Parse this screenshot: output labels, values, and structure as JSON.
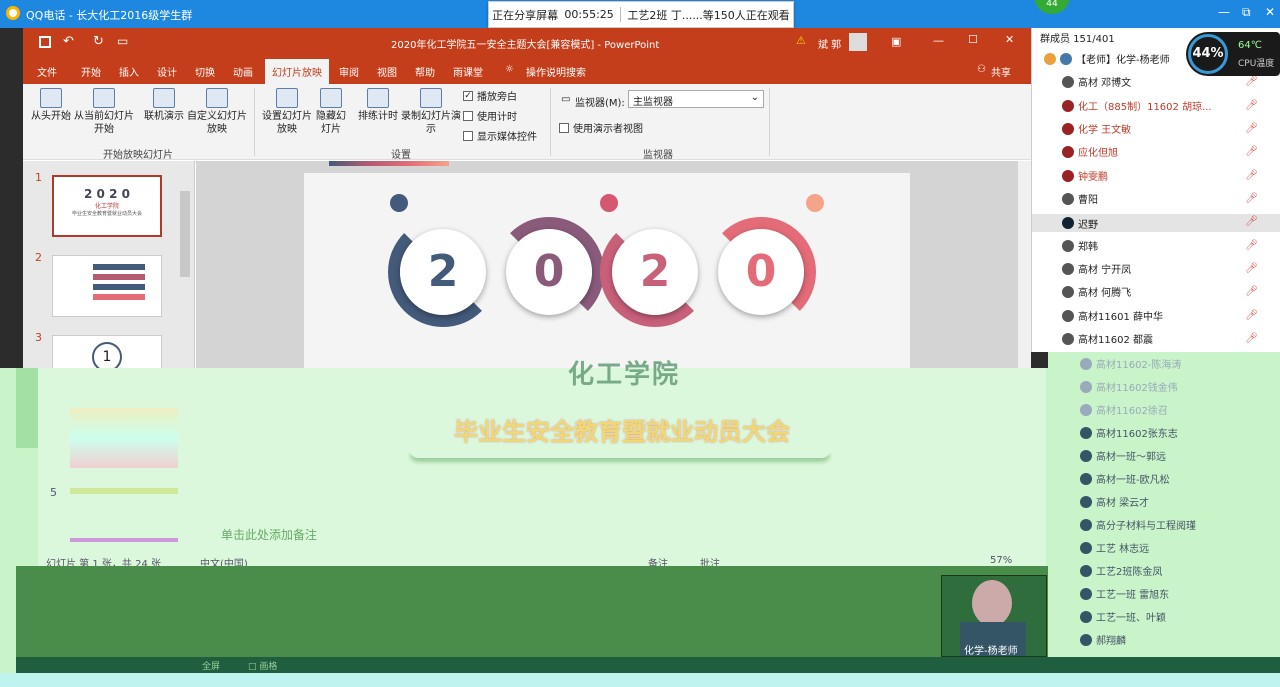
{
  "qq": {
    "title": "QQ电话 - 长大化工2016级学生群",
    "badge": "44",
    "minimize": "—",
    "restore": "⧉",
    "close": "✕"
  },
  "share": {
    "status": "正在分享屏幕",
    "time": "00:55:25",
    "viewers": "工艺2班 丁......等150人正在观看"
  },
  "ppt": {
    "title": "2020年化工学院五一安全主题大会[兼容模式] - PowerPoint",
    "user": "斌 郭",
    "warning": "⚠",
    "tabs": [
      "文件",
      "开始",
      "插入",
      "设计",
      "切换",
      "动画",
      "幻灯片放映",
      "审阅",
      "视图",
      "帮助",
      "雨课堂",
      "操作说明搜索"
    ],
    "share_btn": "共享",
    "ribbon": {
      "from_start": "从头开始",
      "from_current": "从当前幻灯片开始",
      "online": "联机演示",
      "custom": "自定义幻灯片放映",
      "group_start": "开始放映幻灯片",
      "setup": "设置幻灯片放映",
      "hide": "隐藏幻灯片",
      "rehearse": "排练计时",
      "record": "录制幻灯片演示",
      "group_setup": "设置",
      "chk_narration": "播放旁白",
      "chk_timing": "使用计时",
      "chk_media": "显示媒体控件",
      "monitor_label": "监视器(M):",
      "monitor_value": "主监视器",
      "chk_presenter": "使用演示者视图",
      "group_monitor": "监视器"
    },
    "slides": [
      "1",
      "2",
      "3"
    ],
    "thumb1_title": "化工学院",
    "thumb1_sub": "毕业生安全教育暨就业动员大会",
    "slide_digits": [
      "2",
      "0",
      "2",
      "0"
    ],
    "slide_title": "化工学院"
  },
  "overlay": {
    "slide_subtitle": "毕业生安全教育暨就业动员大会",
    "slide5": "5",
    "notes": "单击此处添加备注",
    "status_left": "幻灯片 第 1 张，共 24 张",
    "lang": "中文(中国)",
    "notes_btn": "备注",
    "comments_btn": "批注",
    "zoom": "57%",
    "webcam_name": "化学-杨老师",
    "fullscreen": "全屏",
    "status_bar_x": "□ 画格"
  },
  "chat": {
    "count": "群成员 151/401",
    "members": [
      {
        "name": "【老师】化学-杨老师",
        "red": false
      },
      {
        "name": "高材 邓博文",
        "red": false
      },
      {
        "name": "化工（885制）11602 胡琼...",
        "red": true
      },
      {
        "name": "化学 王文敏",
        "red": true
      },
      {
        "name": "应化但旭",
        "red": true
      },
      {
        "name": "钟雯鹏",
        "red": true
      },
      {
        "name": "曹阳",
        "red": false
      },
      {
        "name": "迟野",
        "red": false
      },
      {
        "name": "郑韩",
        "red": false
      },
      {
        "name": "高材 宁开凤",
        "red": false
      },
      {
        "name": "高材 何腾飞",
        "red": false
      },
      {
        "name": "高材11601 薛中华",
        "red": false
      },
      {
        "name": "高材11602 都震",
        "red": false
      }
    ],
    "green_members": [
      "高材11602-陈海涛",
      "高材11602钱金伟",
      "高材11602徐召",
      "高材11602张东志",
      "高材一班～郭远",
      "高材一班-欧凡松",
      "高材 梁云才",
      "高分子材料与工程阅瑾",
      "工艺 林志远",
      "工艺2班陈金凤",
      "工艺一班 雷旭东",
      "工艺一班、叶颖",
      "郝翔麟"
    ],
    "cpu_pct": "44%",
    "cpu_temp": "64℃",
    "cpu_label": "CPU温度"
  }
}
